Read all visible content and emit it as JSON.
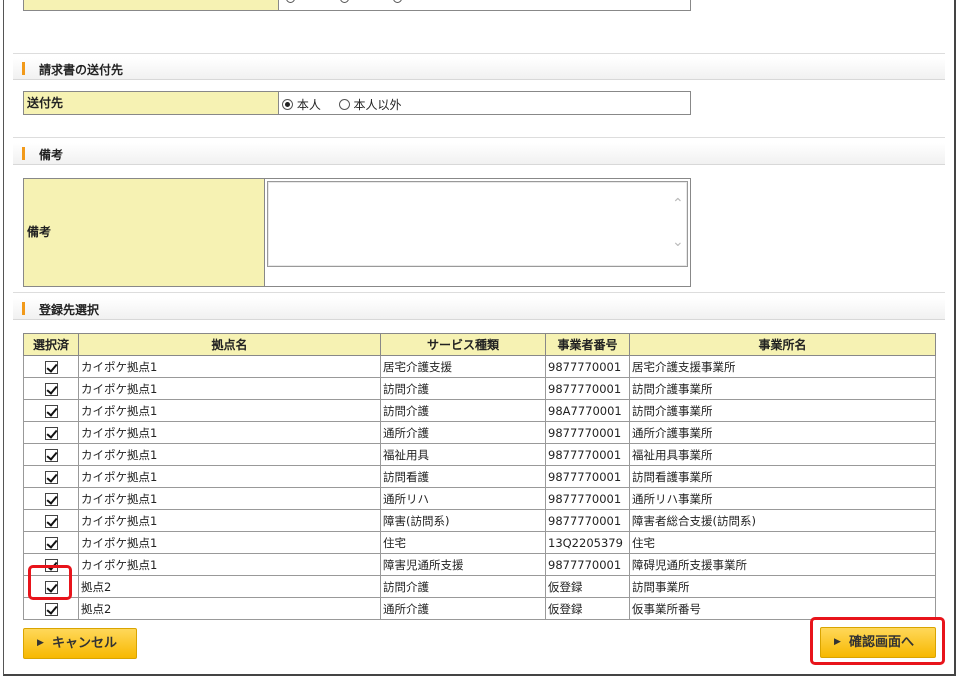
{
  "sections": {
    "invoice_destination": {
      "title": "請求書の送付先",
      "row_label": "送付先",
      "options": [
        {
          "label": "本人",
          "selected": true
        },
        {
          "label": "本人以外",
          "selected": false
        }
      ]
    },
    "remarks": {
      "title": "備考",
      "row_label": "備考",
      "value": ""
    },
    "registration": {
      "title": "登録先選択",
      "columns": [
        "選択済",
        "拠点名",
        "サービス種類",
        "事業者番号",
        "事業所名"
      ],
      "rows": [
        {
          "checked": true,
          "base": "カイポケ拠点1",
          "service": "居宅介護支援",
          "number": "9877770001",
          "office": "居宅介護支援事業所"
        },
        {
          "checked": true,
          "base": "カイポケ拠点1",
          "service": "訪問介護",
          "number": "9877770001",
          "office": "訪問介護事業所"
        },
        {
          "checked": true,
          "base": "カイポケ拠点1",
          "service": "訪問介護",
          "number": "98A7770001",
          "office": "訪問介護事業所"
        },
        {
          "checked": true,
          "base": "カイポケ拠点1",
          "service": "通所介護",
          "number": "9877770001",
          "office": "通所介護事業所"
        },
        {
          "checked": true,
          "base": "カイポケ拠点1",
          "service": "福祉用具",
          "number": "9877770001",
          "office": "福祉用具事業所"
        },
        {
          "checked": true,
          "base": "カイポケ拠点1",
          "service": "訪問看護",
          "number": "9877770001",
          "office": "訪問看護事業所"
        },
        {
          "checked": true,
          "base": "カイポケ拠点1",
          "service": "通所リハ",
          "number": "9877770001",
          "office": "通所リハ事業所"
        },
        {
          "checked": true,
          "base": "カイポケ拠点1",
          "service": "障害(訪問系)",
          "number": "9877770001",
          "office": "障害者総合支援(訪問系)"
        },
        {
          "checked": true,
          "base": "カイポケ拠点1",
          "service": "住宅",
          "number": "13Q2205379",
          "office": "住宅"
        },
        {
          "checked": true,
          "base": "カイポケ拠点1",
          "service": "障害児通所支援",
          "number": "9877770001",
          "office": "障碍児通所支援事業所"
        },
        {
          "checked": true,
          "base": "拠点2",
          "service": "訪問介護",
          "number": "仮登録",
          "office": "訪問事業所"
        },
        {
          "checked": true,
          "base": "拠点2",
          "service": "通所介護",
          "number": "仮登録",
          "office": "仮事業所番号"
        }
      ]
    }
  },
  "buttons": {
    "cancel_label": "キャンセル",
    "confirm_label": "確認画面へ"
  },
  "colors": {
    "label_bg": "#f6f2b3",
    "accent_bar": "#f29a1a",
    "button": "#f7b800",
    "highlight": "#e8141b"
  },
  "icons": {
    "section_marker": "orange-bar-icon",
    "button_arrow": "triangle-right-icon",
    "checkbox": "checkmark-icon"
  }
}
